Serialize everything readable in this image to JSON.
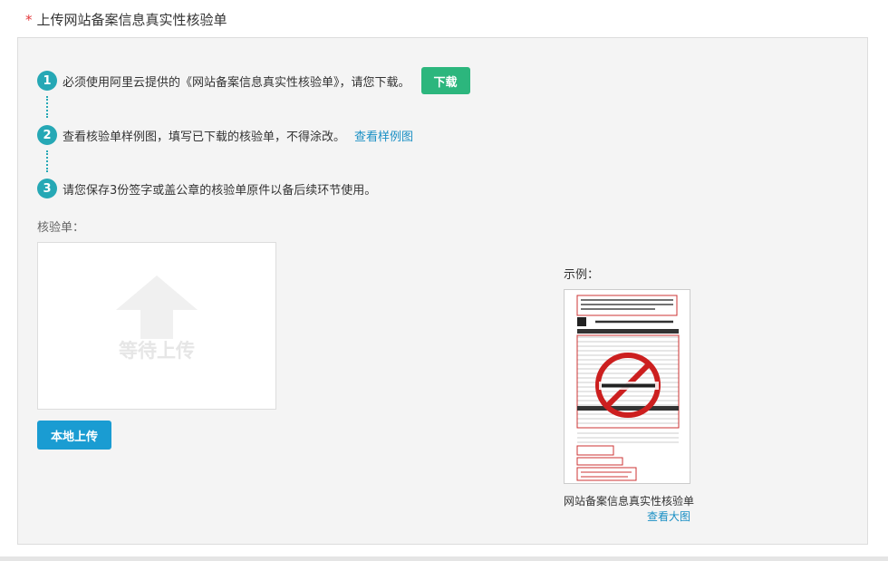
{
  "heading": {
    "required_mark": "*",
    "title": "上传网站备案信息真实性核验单"
  },
  "steps": [
    {
      "num": "1",
      "text": "必须使用阿里云提供的《网站备案信息真实性核验单》，请您下载。",
      "button_label": "下载"
    },
    {
      "num": "2",
      "text": "查看核验单样例图，填写已下载的核验单，不得涂改。",
      "link_label": "查看样例图"
    },
    {
      "num": "3",
      "text": "请您保存3份签字或盖公章的核验单原件以备后续环节使用。"
    }
  ],
  "upload": {
    "label": "核验单：",
    "placeholder_text": "等待上传",
    "button_label": "本地上传"
  },
  "example": {
    "label": "示例：",
    "caption": "网站备案信息真实性核验单",
    "view_link": "查看大图"
  },
  "colors": {
    "accent_teal": "#26a8b5",
    "download_green": "#2cb67d",
    "upload_blue": "#1a9cd2",
    "link_blue": "#1a8fc4",
    "required_red": "#e4393c"
  }
}
